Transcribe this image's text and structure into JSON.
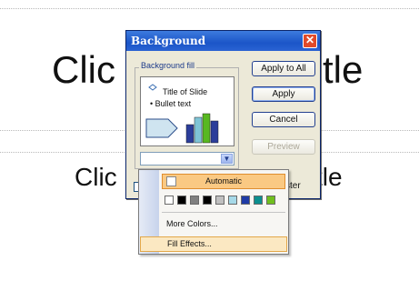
{
  "slide": {
    "title_left": "Clic",
    "title_right": "tle",
    "subtitle_left": "Clic",
    "subtitle_right": "tle"
  },
  "dialog": {
    "title": "Background",
    "group_label": "Background fill",
    "preview": {
      "title_text": "Title of Slide",
      "bullet_text": "Bullet text"
    },
    "buttons": {
      "apply_to_all": "Apply to All",
      "apply": "Apply",
      "cancel": "Cancel",
      "preview": "Preview"
    },
    "omit_master_text": "ster"
  },
  "color_popup": {
    "automatic_label": "Automatic",
    "swatches": [
      "#ffffff",
      "#000000",
      "#808080",
      "#000000",
      "#c0c0c0",
      "#a6d9e8",
      "#1f3ba6",
      "#0c8f8f",
      "#70bf1e"
    ],
    "more_colors": "More Colors...",
    "fill_effects": "Fill Effects..."
  },
  "colors": {
    "titlebar": "#1b55c8",
    "selected_item": "#fac983",
    "hover_item": "#fbe8c2"
  }
}
